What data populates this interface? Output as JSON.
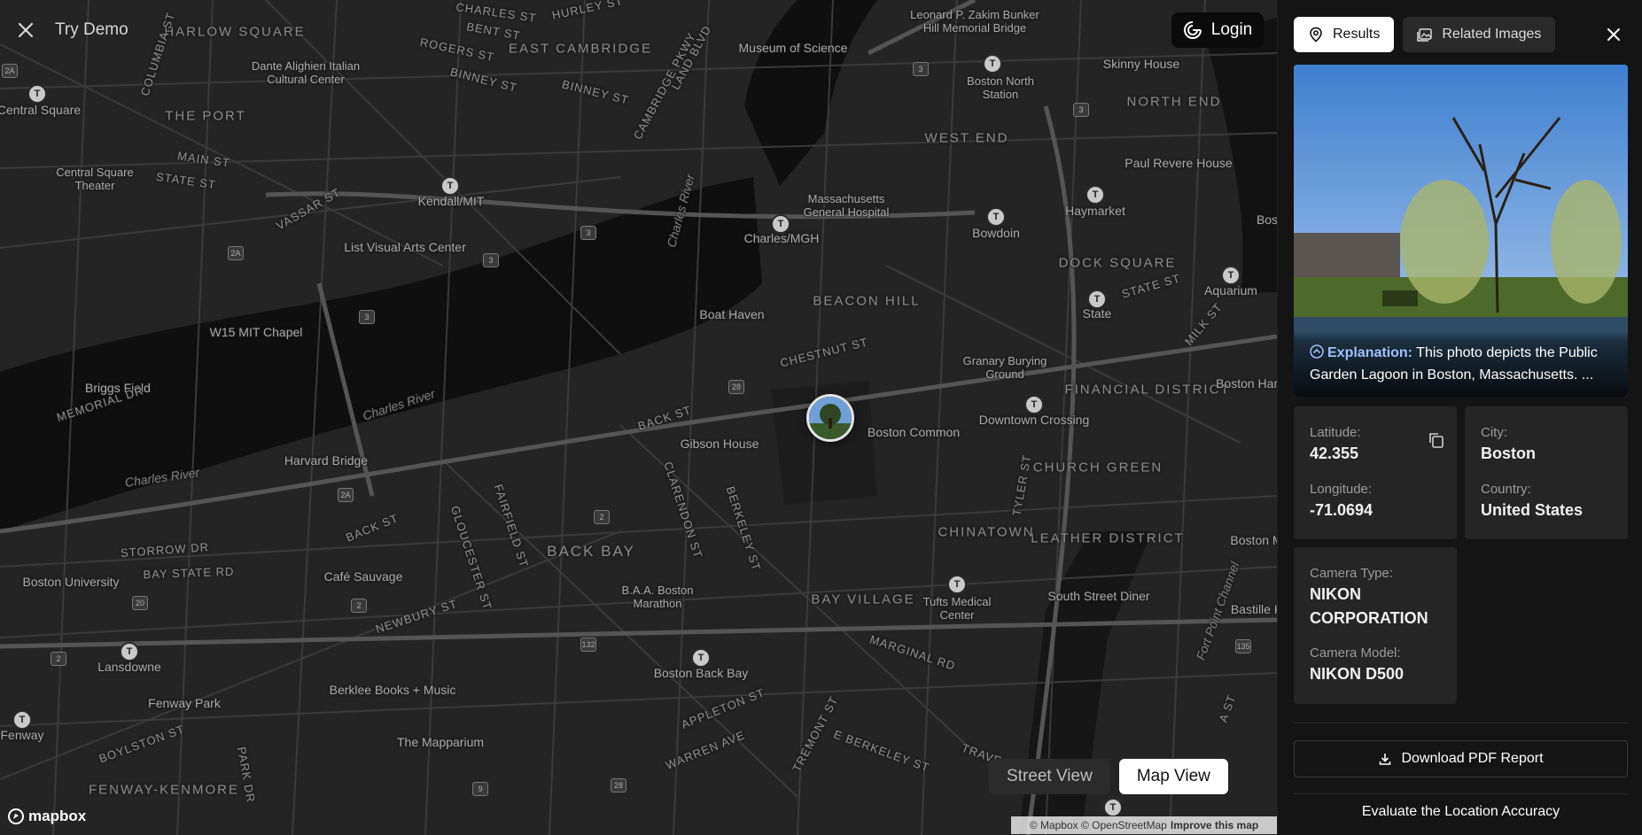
{
  "header": {
    "try_demo": "Try Demo",
    "login": "Login"
  },
  "map": {
    "districts": [
      "HARLOW SQUARE",
      "EAST CAMBRIDGE",
      "THE PORT",
      "WEST END",
      "NORTH END",
      "BEACON HILL",
      "DOCK SQUARE",
      "FINANCIAL DISTRICT",
      "CHURCH GREEN",
      "LEATHER DISTRICT",
      "BACK BAY",
      "BAY VILLAGE",
      "CHINATOWN",
      "FENWAY-KENMORE"
    ],
    "places": [
      "Museum of Science",
      "Leonard P. Zakim Bunker Hill Memorial Bridge",
      "Dante Alighieri Italian Cultural Center",
      "Central Square",
      "Skinny House",
      "Boston North Station",
      "Paul Revere House",
      "Central Square Theater",
      "Kendall/MIT",
      "Massachusetts General Hospital",
      "Haymarket",
      "Charles/MGH",
      "Bowdoin",
      "List Visual Arts Center",
      "Boat Haven",
      "State",
      "Aquarium",
      "W15 MIT Chapel",
      "Granary Burying Ground",
      "Briggs Field",
      "Boston Common",
      "Downtown Crossing",
      "Gibson House",
      "Harvard Bridge",
      "Boston University",
      "Café Sauvage",
      "B.A.A. Boston Marathon",
      "Tufts Medical Center",
      "South Street Diner",
      "Lansdowne",
      "Berklee Books + Music",
      "Boston Back Bay",
      "Fenway Park",
      "The Mapparium",
      "Fenway",
      "Bastille K",
      "Boston Harb",
      "Boston M",
      "Bos"
    ],
    "water": [
      "Charles River",
      "Charles River",
      "Charles River",
      "Fort Point Channel"
    ],
    "streets": [
      "CHARLES ST",
      "BENT ST",
      "ROGERS ST",
      "BINNEY ST",
      "BINNEY ST",
      "HURLEY ST",
      "LAND BLVD",
      "CAMBRIDGE PKWY",
      "COLUMBIA ST",
      "MAIN ST",
      "STATE ST",
      "VASSAR ST",
      "MEMORIAL DR",
      "CHESTNUT ST",
      "BACK ST",
      "STATE ST",
      "MILK ST",
      "STORROW DR",
      "BAY STATE RD",
      "BACK ST",
      "FAIRFIELD ST",
      "GLOUCESTER ST",
      "NEWBURY ST",
      "CLARENDON ST",
      "BERKELEY ST",
      "MARGINAL RD",
      "TYLER ST",
      "APPLETON ST",
      "WARREN AVE",
      "TREMONT ST",
      "E BERKELEY ST",
      "BOYLSTON ST",
      "PARK DR",
      "A ST",
      "TRAVE"
    ],
    "view_toggle": {
      "street_view": "Street View",
      "map_view": "Map View"
    },
    "logo": "mapbox",
    "attribution": {
      "text": "© Mapbox © OpenStreetMap",
      "link": "Improve this map"
    }
  },
  "panel": {
    "tabs": {
      "results": "Results",
      "related": "Related Images"
    },
    "explanation_label": "Explanation:",
    "explanation_text": "This photo depicts the Public Garden Lagoon in Boston, Massachusetts. ...",
    "location": {
      "latitude_label": "Latitude:",
      "latitude": "42.355",
      "longitude_label": "Longitude:",
      "longitude": "-71.0694",
      "city_label": "City:",
      "city": "Boston",
      "country_label": "Country:",
      "country": "United States"
    },
    "camera": {
      "type_label": "Camera Type:",
      "type": "NIKON CORPORATION",
      "model_label": "Camera Model:",
      "model": "NIKON D500"
    },
    "download": "Download PDF Report",
    "evaluate": "Evaluate the Location Accuracy"
  },
  "colors": {
    "map_bg": "#242424",
    "water": "#0f0f0f",
    "road": "#4a4a4a",
    "panel_bg": "#141414",
    "card_bg": "#252525",
    "accent": "#9ec0ff"
  }
}
